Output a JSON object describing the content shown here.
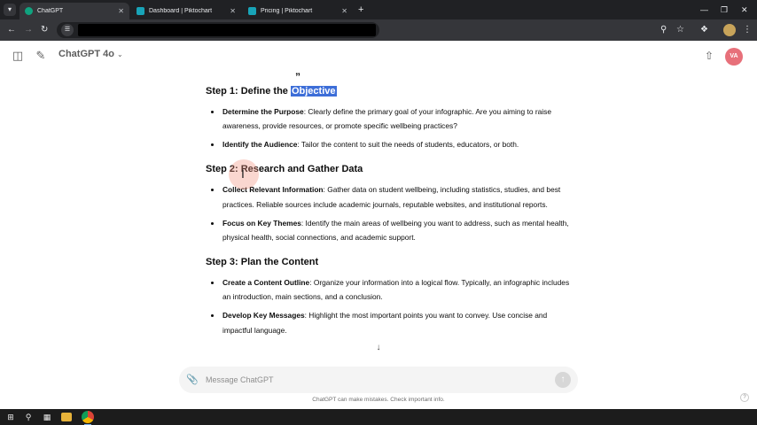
{
  "browser": {
    "tabs": [
      {
        "title": "ChatGPT",
        "active": true
      },
      {
        "title": "Dashboard | Piktochart",
        "active": false
      },
      {
        "title": "Pricing | Piktochart",
        "active": false
      }
    ]
  },
  "header": {
    "model_name": "ChatGPT 4o",
    "avatar_initials": "VA"
  },
  "content": {
    "quote_mark": "”",
    "steps": [
      {
        "title_prefix": "Step 1: Define the ",
        "title_highlight": "Objective",
        "bullets": [
          {
            "term": "Determine the Purpose",
            "text": ": Clearly define the primary goal of your infographic. Are you aiming to raise awareness, provide resources, or promote specific wellbeing practices?"
          },
          {
            "term": "Identify the Audience",
            "text": ": Tailor the content to suit the needs of students, educators, or both."
          }
        ]
      },
      {
        "title_prefix": "Step 2: Research and Gather Data",
        "bullets": [
          {
            "term": "Collect Relevant Information",
            "text": ": Gather data on student wellbeing, including statistics, studies, and best practices. Reliable sources include academic journals, reputable websites, and institutional reports."
          },
          {
            "term": "Focus on Key Themes",
            "text": ": Identify the main areas of wellbeing you want to address, such as mental health, physical health, social connections, and academic support."
          }
        ]
      },
      {
        "title_prefix": "Step 3: Plan the Content",
        "bullets": [
          {
            "term": "Create a Content Outline",
            "text": ": Organize your information into a logical flow. Typically, an infographic includes an introduction, main sections, and a conclusion."
          },
          {
            "term": "Develop Key Messages",
            "text": ": Highlight the most important points you want to convey. Use concise and impactful language."
          }
        ]
      }
    ]
  },
  "composer": {
    "placeholder": "Message ChatGPT",
    "disclaimer": "ChatGPT can make mistakes. Check important info."
  }
}
